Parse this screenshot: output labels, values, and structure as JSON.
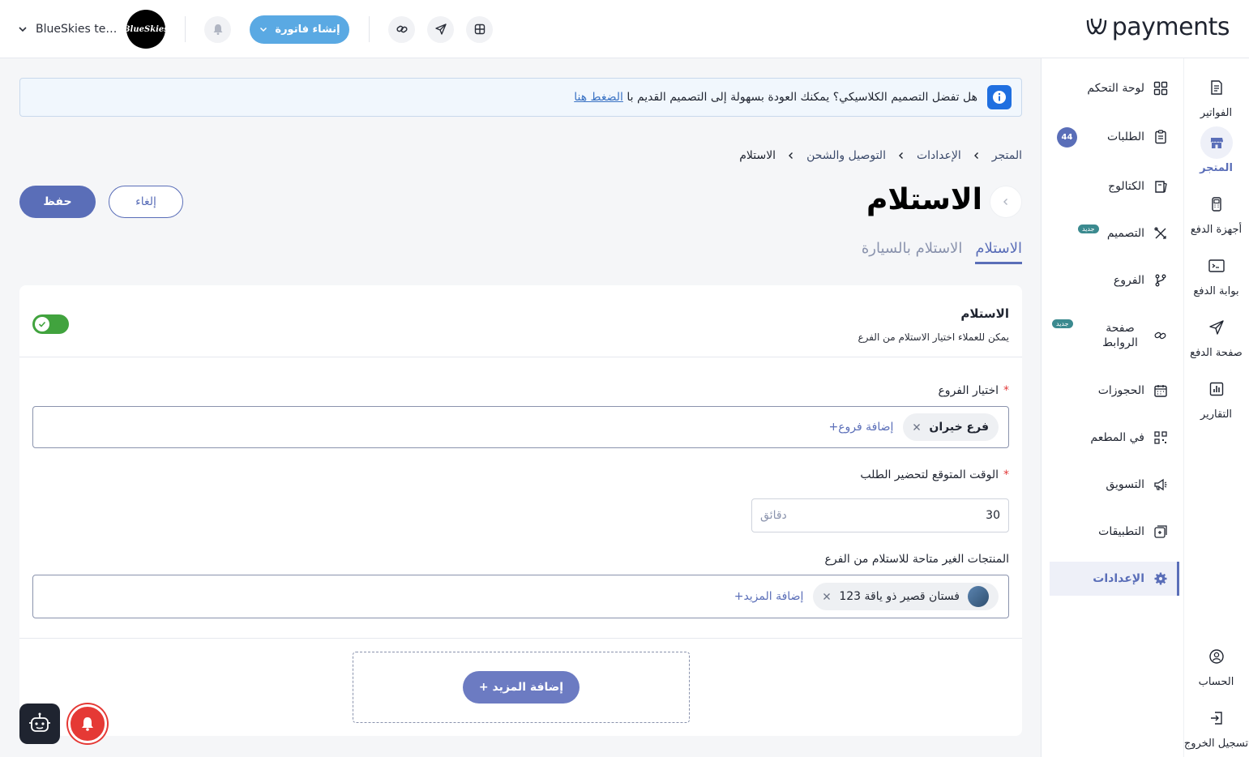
{
  "topbar": {
    "brand": "payments",
    "store_name": "BlueSkies testi...",
    "store_avatar_text": "BlueSkies",
    "create_invoice_label": "إنشاء فاتورة",
    "icons": [
      "chevron-down-icon",
      "bell-icon",
      "link-icon",
      "send-icon",
      "grid-icon"
    ]
  },
  "sidebar_primary": {
    "items": [
      {
        "label": "الفواتير",
        "icon": "invoice-icon"
      },
      {
        "label": "المتجر",
        "icon": "store-icon",
        "active": true
      },
      {
        "label": "أجهزة الدفع",
        "icon": "pos-device-icon"
      },
      {
        "label": "بوابة الدفع",
        "icon": "gateway-icon"
      },
      {
        "label": "صفحة الدفع",
        "icon": "send-icon"
      },
      {
        "label": "التقارير",
        "icon": "reports-icon"
      }
    ],
    "bottom": [
      {
        "label": "الحساب",
        "icon": "account-icon"
      },
      {
        "label": "تسجيل الخروج",
        "icon": "logout-icon"
      }
    ]
  },
  "sidebar_secondary": {
    "items": [
      {
        "label": "لوحة التحكم",
        "icon": "dashboard-icon"
      },
      {
        "label": "الطلبات",
        "icon": "orders-icon",
        "badge": "44"
      },
      {
        "label": "الكتالوج",
        "icon": "catalog-icon"
      },
      {
        "label": "التصميم",
        "icon": "design-icon",
        "new_badge": "جديد"
      },
      {
        "label": "الفروع",
        "icon": "branches-icon"
      },
      {
        "label": "صفحة الروابط",
        "icon": "links-icon",
        "new_badge": "جديد"
      },
      {
        "label": "الحجوزات",
        "icon": "calendar-icon"
      },
      {
        "label": "في المطعم",
        "icon": "qr-icon"
      },
      {
        "label": "التسويق",
        "icon": "megaphone-icon"
      },
      {
        "label": "التطبيقات",
        "icon": "apps-icon"
      },
      {
        "label": "الإعدادات",
        "icon": "gear-icon",
        "active": true
      }
    ]
  },
  "banner": {
    "text": "هل تفضل التصميم الكلاسيكي؟ يمكنك العودة بسهولة إلى التصميم القديم با",
    "link": "الضغط هنا"
  },
  "breadcrumb": [
    "المتجر",
    "الإعدادات",
    "التوصيل والشحن",
    "الاستلام"
  ],
  "page": {
    "title": "الاستلام",
    "save_label": "حفظ",
    "cancel_label": "إلغاء",
    "tabs": [
      {
        "label": "الاستلام",
        "active": true
      },
      {
        "label": "الاستلام بالسيارة",
        "active": false
      }
    ]
  },
  "pickup": {
    "title": "الاستلام",
    "description": "يمكن للعملاء اختيار الاستلام من الفرع",
    "enabled": true,
    "branches_label": "اختيار الفروع",
    "required_mark": "*",
    "branch_chips": [
      "فرع خيران"
    ],
    "add_branches_label": "+إضافة فروع",
    "prep_time_label": "الوقت المتوقع لتحضير الطلب",
    "prep_time_value": "30",
    "prep_time_unit": "دقائق",
    "unavailable_label": "المنتجات الغير متاحة للاستلام من الفرع",
    "product_chips": [
      "فستان قصير ذو ياقة 123"
    ],
    "add_more_link": "+إضافة المزيد",
    "add_more_button": "+ إضافة المزيد"
  },
  "colors": {
    "accent": "#5a6eb8",
    "create_button": "#5aa9e3",
    "toggle_on": "#41a33e",
    "required": "#e23b3b"
  }
}
